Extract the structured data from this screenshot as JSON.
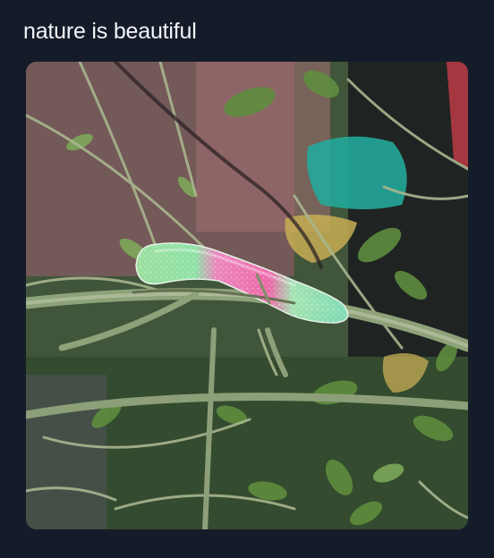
{
  "post": {
    "caption": "nature is beautiful"
  },
  "photo": {
    "subject_icon": "gummy-worm-on-branch-icon"
  },
  "colors": {
    "background": "#151c29",
    "caption_text": "#f2f4f7",
    "gummy_green": "#8fe7a4",
    "gummy_pink": "#f17ab8",
    "leaf_green": "#5f8e3f",
    "branch": "#8ea27a"
  }
}
